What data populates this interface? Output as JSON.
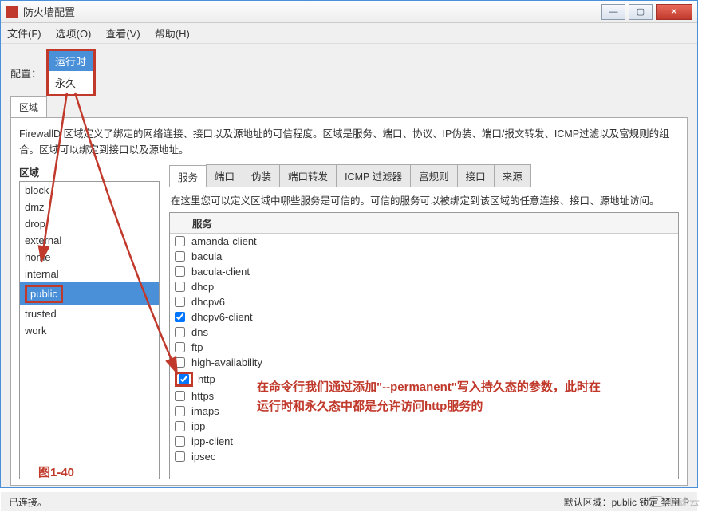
{
  "window": {
    "title": "防火墙配置"
  },
  "menu": {
    "file": "文件(F)",
    "options": "选项(O)",
    "view": "查看(V)",
    "help": "帮助(H)"
  },
  "config": {
    "label": "配置：",
    "opt_runtime": "运行时",
    "opt_permanent": "永久"
  },
  "zonetab": "区域",
  "description": "FirewallD 区域定义了绑定的网络连接、接口以及源地址的可信程度。区域是服务、端口、协议、IP伪装、端口/报文转发、ICMP过滤以及富规则的组合。区域可以绑定到接口以及源地址。",
  "zones_header": "区域",
  "zones": [
    "block",
    "dmz",
    "drop",
    "external",
    "home",
    "internal",
    "public",
    "trusted",
    "work"
  ],
  "tabs": [
    "服务",
    "端口",
    "伪装",
    "端口转发",
    "ICMP 过滤器",
    "富规则",
    "接口",
    "来源"
  ],
  "svc_desc": "在这里您可以定义区域中哪些服务是可信的。可信的服务可以被绑定到该区域的任意连接、接口、源地址访问。",
  "svc_col_hdr": "服务",
  "services": [
    {
      "name": "amanda-client",
      "checked": false
    },
    {
      "name": "bacula",
      "checked": false
    },
    {
      "name": "bacula-client",
      "checked": false
    },
    {
      "name": "dhcp",
      "checked": false
    },
    {
      "name": "dhcpv6",
      "checked": false
    },
    {
      "name": "dhcpv6-client",
      "checked": true
    },
    {
      "name": "dns",
      "checked": false
    },
    {
      "name": "ftp",
      "checked": false
    },
    {
      "name": "high-availability",
      "checked": false
    },
    {
      "name": "http",
      "checked": true,
      "highlight": true
    },
    {
      "name": "https",
      "checked": false
    },
    {
      "name": "imaps",
      "checked": false
    },
    {
      "name": "ipp",
      "checked": false
    },
    {
      "name": "ipp-client",
      "checked": false
    },
    {
      "name": "ipsec",
      "checked": false
    }
  ],
  "figure_label": "图1-40",
  "annotation_line1": "在命令行我们通过添加\"--permanent\"写入持久态的参数，此时在",
  "annotation_line2": "运行时和永久态中都是允许访问http服务的",
  "status_left": "已连接。",
  "status_right": "默认区域：public 锁定 禁用 P",
  "watermark": "亿速云"
}
